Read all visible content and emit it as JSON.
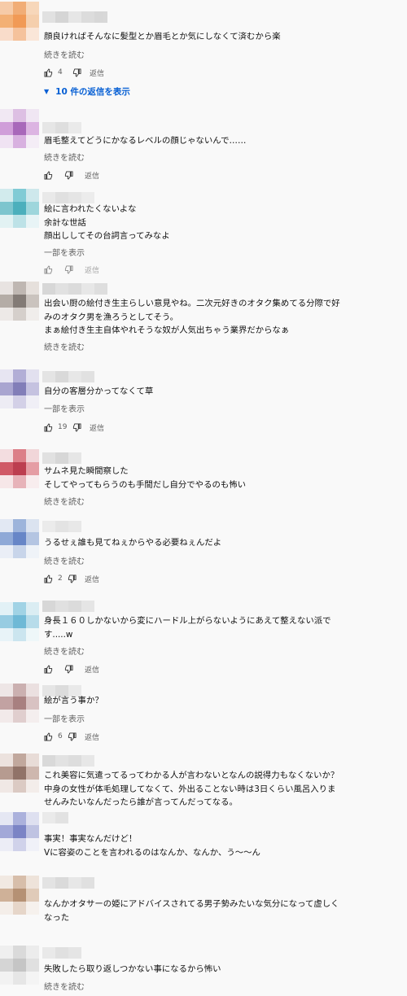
{
  "labels": {
    "read_more": "続きを読む",
    "show_part": "一部を表示",
    "reply": "返信"
  },
  "replies_link": "10 件の返信を表示",
  "comments": [
    {
      "text": "顔良ければそんなに髪型とか眉毛とか気にしなくて済むから楽",
      "more": "続きを読む",
      "likes": "4",
      "avatar": [
        "#f6c39a",
        "#f0a060",
        "#f7d2b0",
        "#f2a45e",
        "#f08a3a",
        "#f5c8a0",
        "#fad8c2",
        "#f5b98c",
        "#fbe3d3"
      ],
      "name": [
        "#cfcfcf",
        "#b9b9b9",
        "#d8d8d8",
        "#c6c6c6",
        "#bdbdbd"
      ]
    },
    {
      "text": "眉毛整えてどうにかなるレベルの顔じゃないんで……",
      "more": "続きを読む",
      "likes": "",
      "avatar": [
        "#f0e6f3",
        "#d9b6e0",
        "#efe3f2",
        "#c98fd4",
        "#9a4fb0",
        "#d7a8df",
        "#efe0f2",
        "#d3a5dc",
        "#f4ecf6"
      ],
      "name": [
        "#d8d8d8",
        "#c8c8c8",
        "#dedede"
      ]
    },
    {
      "text": "絵に言われたくないよな\n余計な世話\n顔出ししてその台詞言ってみなよ",
      "more": "一部を表示",
      "likes": "",
      "avatar": [
        "#cce9ec",
        "#6dc4cf",
        "#c7e6ea",
        "#68bcc7",
        "#2ea3b2",
        "#8fd0d8",
        "#dff1f3",
        "#b3dfe5",
        "#e6f4f6"
      ],
      "name": [
        "#dcdcdc",
        "#cdcdcd",
        "#d6d6d6",
        "#e2e2e2"
      ]
    },
    {
      "text": "出会い厨の絵付き生主らしい意見やね。二次元好きのオタク集めてる分際で好\nみのオタク男を漁ろうとしてそう。\nまぁ絵付き生主自体やれそうな奴が人気出ちゃう業界だからなぁ",
      "more": "続きを読む",
      "likes": "",
      "avatar": [
        "#e6e0dd",
        "#b5aca6",
        "#e3dcd8",
        "#a99f98",
        "#6f6660",
        "#c2bab4",
        "#ece7e4",
        "#cfc8c3",
        "#efebe9"
      ],
      "name": [
        "#bcbcbc",
        "#cfcfcf",
        "#c4c4c4",
        "#d9d9d9",
        "#c9c9c9"
      ]
    },
    {
      "text": "自分の客層分かってなくて草",
      "more": "一部を表示",
      "likes": "19",
      "avatar": [
        "#e4e2f1",
        "#a6a2d0",
        "#dedcee",
        "#9c97ca",
        "#6e69ad",
        "#bdb9dc",
        "#ebeaf4",
        "#cdcae4",
        "#efeef6"
      ],
      "name": [
        "#d4d4d4",
        "#c0c0c0",
        "#dadada",
        "#cfcfcf"
      ]
    },
    {
      "text": "サムネ見た瞬間察した\nそしてやってもらうのも手間だし自分でやるのも怖い",
      "more": "続きを読む",
      "likes": "",
      "avatar": [
        "#f3d9dc",
        "#d86a75",
        "#f0d0d4",
        "#c93e4d",
        "#b21e32",
        "#e28d96",
        "#f6e4e6",
        "#e5a7ae",
        "#f8eced"
      ],
      "name": [
        "#cfcfcf",
        "#bdbdbd",
        "#d7d7d7"
      ]
    },
    {
      "text": "うるせぇ誰も見てねぇからやる必要ねぇんだよ",
      "more": "続きを読む",
      "likes": "2",
      "avatar": [
        "#dfe6f2",
        "#8ea8d6",
        "#d6e0ef",
        "#7d9cd2",
        "#4e73bf",
        "#a9bddf",
        "#e8edf6",
        "#c0cfe8",
        "#eef2f8"
      ],
      "name": [
        "#e0e0e0",
        "#d2d2d2",
        "#dbdbdb"
      ]
    },
    {
      "text": "身長１６０しかないから変にハードル上がらないようにあえて整えない派で\nす.....w",
      "more": "続きを読む",
      "likes": "",
      "avatar": [
        "#dff0f6",
        "#92cde2",
        "#d6ebf3",
        "#86c5de",
        "#57aed0",
        "#acd8e8",
        "#e6f3f8",
        "#c4e2ee",
        "#edf7fa"
      ],
      "name": [
        "#bdbdbd",
        "#cccccc",
        "#c3c3c3",
        "#d6d6d6"
      ]
    },
    {
      "text": "絵が言う事か？",
      "more": "一部を表示",
      "likes": "6",
      "avatar": [
        "#ede3e3",
        "#c4a4a4",
        "#e9dcdc",
        "#b99393",
        "#9a6b6b",
        "#d3b9b9",
        "#f1e8e8",
        "#dcc7c7",
        "#f4eded"
      ],
      "name": [
        "#d6d6d6",
        "#c6c6c6",
        "#dcdcdc"
      ]
    },
    {
      "text": "これ美容に気遣ってるってわかる人が言わないとなんの説得力もなくないか？\n中身の女性が体毛処理してなくて、外出ることない時は3日くらい風呂入りま\nせんみたいなんだったら誰が言ってんだってなる。",
      "more": "",
      "likes": "",
      "avatar": [
        "#eadfda",
        "#b89a8e",
        "#e6d8d2",
        "#ab8b7e",
        "#7f5c4f",
        "#c7aca1",
        "#efe6e2",
        "#d6c2ba",
        "#f2ebe8"
      ],
      "name": [
        "#bfbfbf",
        "#d0d0d0",
        "#c7c7c7",
        "#dadada"
      ]
    },
    {
      "text": "事実！事実なんだけど！\nVに容姿のことを言われるのはなんか、なんか、う～～ん",
      "more": "",
      "likes": "",
      "avatar": [
        "#e2e4f3",
        "#9ea5d8",
        "#dadcef",
        "#949bd3",
        "#6670bd",
        "#b5badf",
        "#eaebf6",
        "#c9cce8",
        "#eff0f8"
      ],
      "name": [
        "#dedede",
        "#d0d0d0"
      ]
    },
    {
      "text": "なんかオタサーの姫にアドバイスされてる男子勢みたいな気分になって虚しく\nなった",
      "more": "",
      "likes": "",
      "avatar": [
        "#f0e7df",
        "#d2b49d",
        "#ede0d5",
        "#c8a588",
        "#aa7f5d",
        "#dcc3af",
        "#f4ede7",
        "#e3d0c1",
        "#f6f0eb"
      ],
      "name": [
        "#d2d2d2",
        "#c2c2c2",
        "#dadada",
        "#cdcdcd"
      ]
    },
    {
      "text": "失敗したら取り返しつかない事になるから怖い",
      "more": "続きを読む",
      "likes": "",
      "avatar": [
        "#eeeeee",
        "#d5d5d5",
        "#eaeaea",
        "#cfcfcf",
        "#bcbcbc",
        "#dcdcdc",
        "#f1f1f1",
        "#e3e3e3",
        "#f4f4f4"
      ],
      "name": [
        "#dcdcdc",
        "#cccccc",
        "#d6d6d6"
      ]
    }
  ]
}
